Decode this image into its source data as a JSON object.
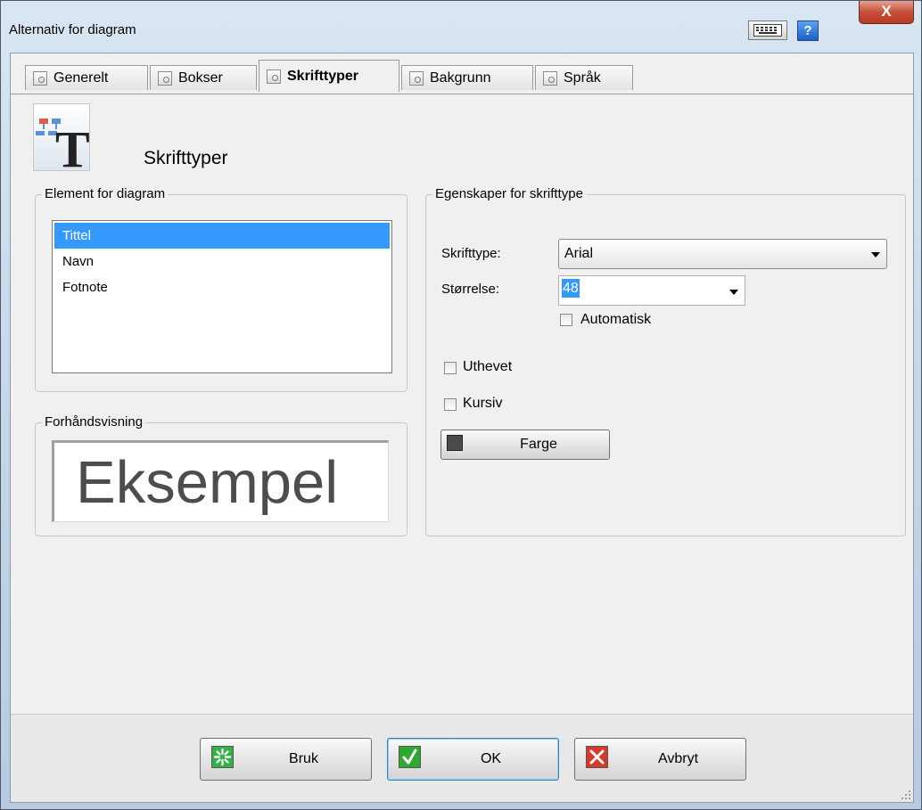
{
  "window": {
    "title": "Alternativ for diagram",
    "help_label": "?",
    "close_label": "X"
  },
  "tabs": [
    {
      "label": "Generelt"
    },
    {
      "label": "Bokser"
    },
    {
      "label": "Skrifttyper",
      "active": true
    },
    {
      "label": "Bakgrunn"
    },
    {
      "label": "Språk"
    }
  ],
  "header": {
    "title": "Skrifttyper",
    "icon": "font-diagram-icon"
  },
  "element_group": {
    "label": "Element for diagram",
    "items": [
      {
        "label": "Tittel",
        "selected": true
      },
      {
        "label": "Navn"
      },
      {
        "label": "Fotnote"
      }
    ]
  },
  "preview_group": {
    "label": "Forhåndsvisning",
    "sample_text": "Eksempel"
  },
  "font_props": {
    "label": "Egenskaper for skrifttype",
    "font_label": "Skrifttype:",
    "font_value": "Arial",
    "size_label": "Størrelse:",
    "size_value": "48",
    "auto_label": "Automatisk",
    "bold_label": "Uthevet",
    "italic_label": "Kursiv",
    "color_label": "Farge",
    "color_swatch": "#4a4a4a"
  },
  "footer": {
    "apply_label": "Bruk",
    "ok_label": "OK",
    "cancel_label": "Avbryt"
  },
  "colors": {
    "selection": "#3399ff",
    "ok_green": "#2ea82e",
    "cancel_red": "#d43b2a",
    "apply_green": "#37b04a"
  }
}
